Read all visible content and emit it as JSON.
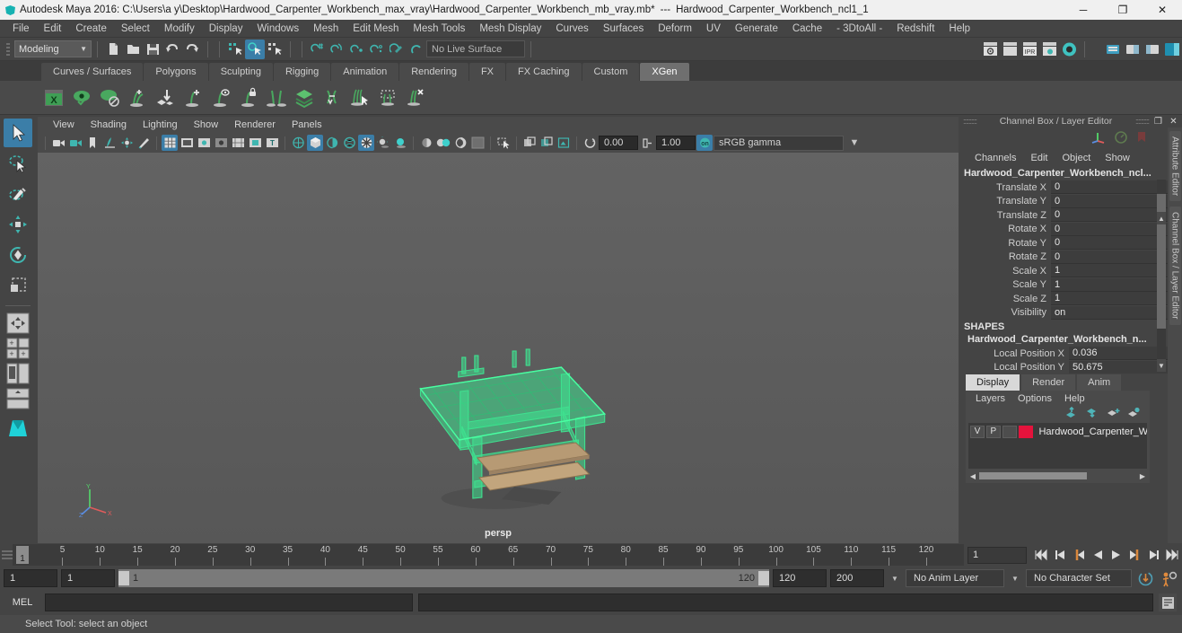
{
  "titlebar": {
    "app_title": "Autodesk Maya 2016: C:\\Users\\a y\\Desktop\\Hardwood_Carpenter_Workbench_max_vray\\Hardwood_Carpenter_Workbench_mb_vray.mb*",
    "separator": "---",
    "object_name": "Hardwood_Carpenter_Workbench_ncl1_1",
    "minimize": "─",
    "maximize": "❐",
    "close": "✕"
  },
  "menubar": {
    "items": [
      "File",
      "Edit",
      "Create",
      "Select",
      "Modify",
      "Display",
      "Windows",
      "Mesh",
      "Edit Mesh",
      "Mesh Tools",
      "Mesh Display",
      "Curves",
      "Surfaces",
      "Deform",
      "UV",
      "Generate",
      "Cache",
      "- 3DtoAll -",
      "Redshift",
      "Help"
    ]
  },
  "statusline": {
    "mode": "Modeling",
    "live_surface": "No Live Surface"
  },
  "shelf": {
    "tabs": [
      "Curves / Surfaces",
      "Polygons",
      "Sculpting",
      "Rigging",
      "Animation",
      "Rendering",
      "FX",
      "FX Caching",
      "Custom",
      "XGen"
    ],
    "active_tab": "XGen"
  },
  "viewport": {
    "menus": [
      "View",
      "Shading",
      "Lighting",
      "Show",
      "Renderer",
      "Panels"
    ],
    "exposure_value": "0.00",
    "gamma_value": "1.00",
    "color_space": "sRGB gamma",
    "camera_label": "persp"
  },
  "channelbox": {
    "panel_title": "Channel Box / Layer Editor",
    "menus": [
      "Channels",
      "Edit",
      "Object",
      "Show"
    ],
    "object_name": "Hardwood_Carpenter_Workbench_ncl...",
    "transform_rows": [
      {
        "label": "Translate X",
        "value": "0"
      },
      {
        "label": "Translate Y",
        "value": "0"
      },
      {
        "label": "Translate Z",
        "value": "0"
      },
      {
        "label": "Rotate X",
        "value": "0"
      },
      {
        "label": "Rotate Y",
        "value": "0"
      },
      {
        "label": "Rotate Z",
        "value": "0"
      },
      {
        "label": "Scale X",
        "value": "1"
      },
      {
        "label": "Scale Y",
        "value": "1"
      },
      {
        "label": "Scale Z",
        "value": "1"
      },
      {
        "label": "Visibility",
        "value": "on"
      }
    ],
    "shapes_header": "SHAPES",
    "shape_name": "Hardwood_Carpenter_Workbench_n...",
    "shape_rows": [
      {
        "label": "Local Position X",
        "value": "0.036"
      },
      {
        "label": "Local Position Y",
        "value": "50.675"
      }
    ],
    "side_tabs": [
      "Attribute Editor",
      "Channel Box / Layer Editor"
    ]
  },
  "layereditor": {
    "tabs": [
      "Display",
      "Render",
      "Anim"
    ],
    "active_tab": "Display",
    "menus": [
      "Layers",
      "Options",
      "Help"
    ],
    "layer": {
      "visibility": "V",
      "playback": "P",
      "type": "",
      "color": "#e4133c",
      "name": "Hardwood_Carpenter_W"
    }
  },
  "timeslider": {
    "current_frame": "1",
    "ticks": [
      5,
      10,
      15,
      20,
      25,
      30,
      35,
      40,
      45,
      50,
      55,
      60,
      65,
      70,
      75,
      80,
      85,
      90,
      95,
      100,
      105,
      110,
      115,
      120
    ],
    "range_start": 1,
    "range_end": 120,
    "frame_field": "1"
  },
  "rangebar": {
    "anim_start": "1",
    "range_start": "1",
    "slider_lo": "1",
    "slider_hi": "120",
    "range_end": "120",
    "anim_end": "200",
    "anim_layer": "No Anim Layer",
    "character_set": "No Character Set"
  },
  "commandline": {
    "language": "MEL",
    "input_value": "",
    "output_value": ""
  },
  "helpline": {
    "text": "Select Tool: select an object"
  },
  "icon_names": {
    "new_scene": "new-file-icon",
    "open_scene": "open-folder-icon",
    "save_scene": "save-disk-icon",
    "undo": "undo-arrow-icon",
    "redo": "redo-arrow-icon",
    "select_tool": "arrow-select-icon",
    "lasso_tool": "lasso-select-icon",
    "paint_select": "paint-brush-select-icon",
    "move_tool": "move-arrows-icon",
    "rotate_tool": "rotate-ring-icon",
    "scale_tool": "scale-box-icon"
  }
}
